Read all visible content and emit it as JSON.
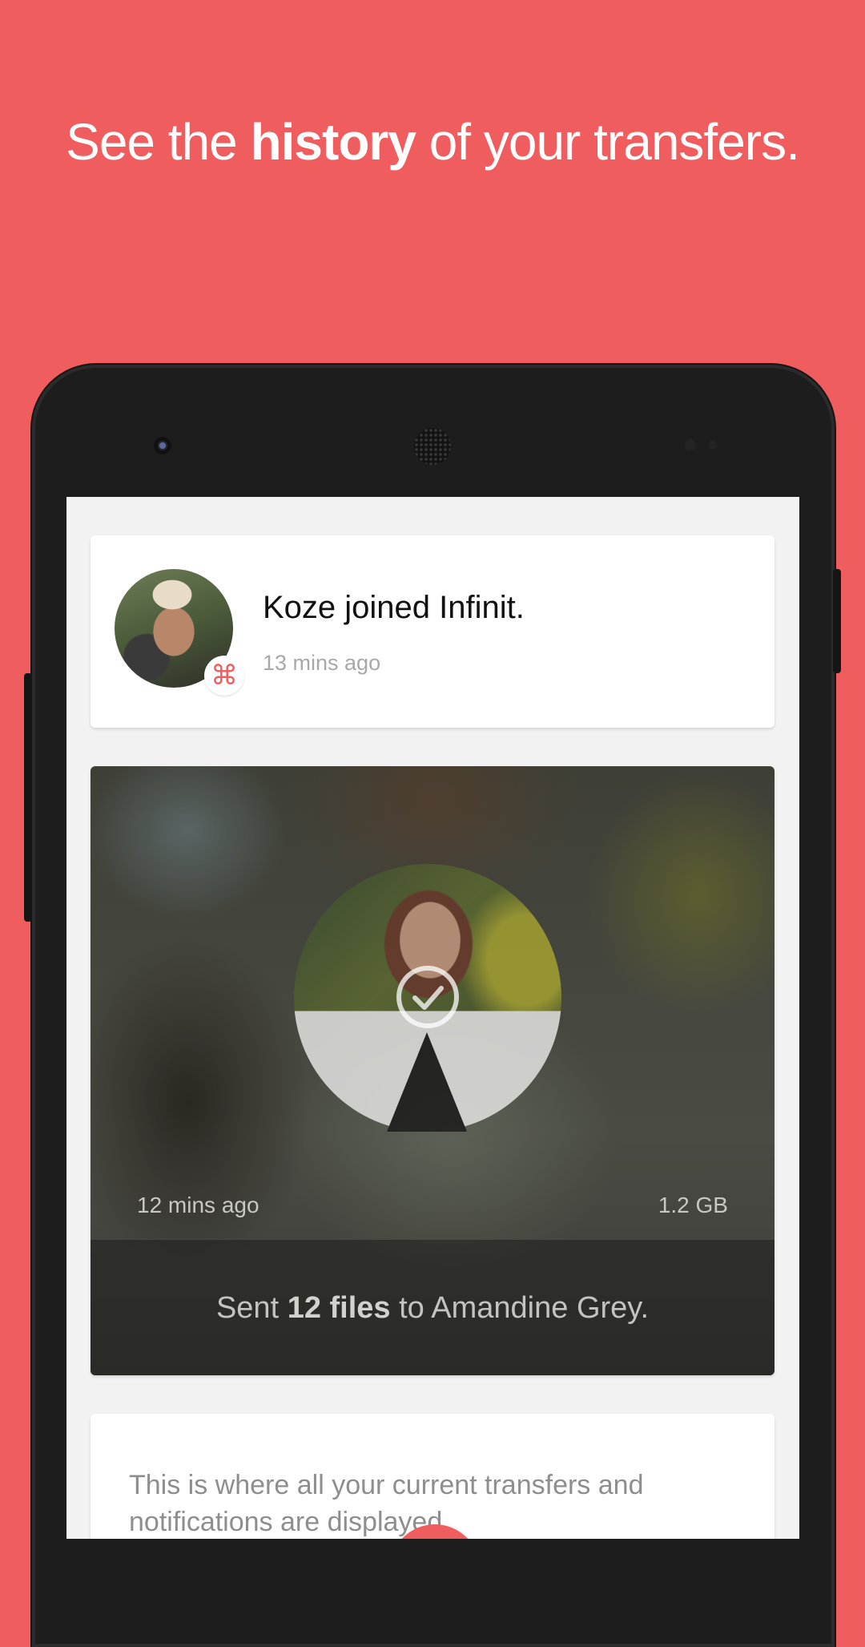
{
  "headline": {
    "pre": "See the",
    "bold": "history",
    "post": "of your transfers."
  },
  "notification_card": {
    "title": "Koze joined Infinit.",
    "time": "13 mins ago",
    "badge_icon": "infinit-logo-icon"
  },
  "transfer_card": {
    "time": "12 mins ago",
    "size": "1.2 GB",
    "status_icon": "check-circle-icon",
    "summary_pre": "Sent",
    "summary_bold": "12 files",
    "summary_post": "to Amandine Grey."
  },
  "info_card": {
    "text": "This is where all your current transfers and notifications are displayed."
  },
  "colors": {
    "brand": "#f05d5e",
    "screen_bg": "#f2f2f2",
    "card_bg": "#ffffff"
  }
}
